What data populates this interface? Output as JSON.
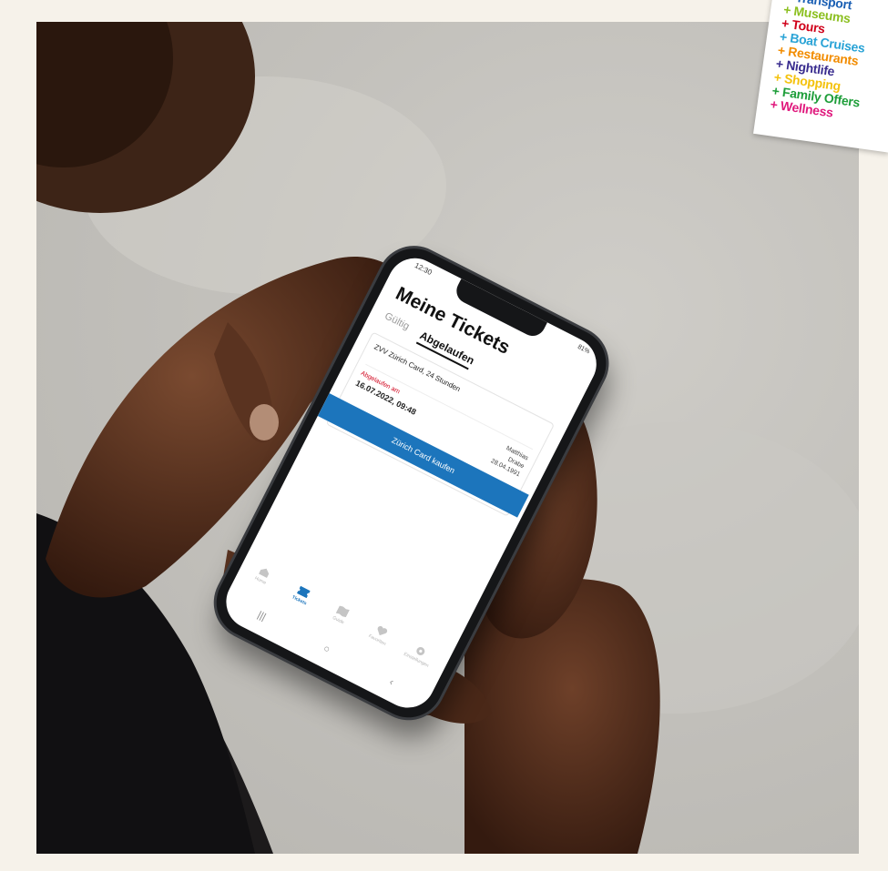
{
  "phone": {
    "status_time": "12:30",
    "status_battery": "81%",
    "title": "Meine Tickets",
    "tabs": [
      {
        "label": "Gültig",
        "active": false
      },
      {
        "label": "Abgelaufen",
        "active": true
      }
    ],
    "ticket": {
      "name": "ZVV Zürich Card, 24 Stunden",
      "expired_label": "Abgelaufen am",
      "expired_date": "16.07.2022, 09:48",
      "holder_first": "Matthias",
      "holder_last": "Drabe",
      "holder_birthdate": "28.04.1991",
      "qr_icon": "qr-code-icon"
    },
    "buy_button": "Zürich Card kaufen",
    "nav": [
      {
        "label": "Home",
        "icon": "home-icon",
        "active": false
      },
      {
        "label": "Tickets",
        "icon": "ticket-icon",
        "active": true
      },
      {
        "label": "Guide",
        "icon": "map-icon",
        "active": false
      },
      {
        "label": "Favoriten",
        "icon": "heart-icon",
        "active": false
      },
      {
        "label": "Einstellungen",
        "icon": "settings-icon",
        "active": false
      }
    ],
    "system_buttons": [
      "|||",
      "○",
      "‹"
    ],
    "accent": "#1c75bc",
    "expired_color": "#d0021b"
  },
  "sticker": {
    "items": [
      {
        "text": "+ Transport",
        "color": "#1a5fb4"
      },
      {
        "text": "+ Museums",
        "color": "#8bbf1f"
      },
      {
        "text": "+ Tours",
        "color": "#d0021b"
      },
      {
        "text": "+ Boat Cruises",
        "color": "#29a3d6"
      },
      {
        "text": "+ Restaurants",
        "color": "#f28c00"
      },
      {
        "text": "+ Nightlife",
        "color": "#3a2d8f"
      },
      {
        "text": "+ Shopping",
        "color": "#f4c20d"
      },
      {
        "text": "+ Family Offers",
        "color": "#1e9e3a"
      },
      {
        "text": "+ Wellness",
        "color": "#e0197d"
      }
    ]
  }
}
